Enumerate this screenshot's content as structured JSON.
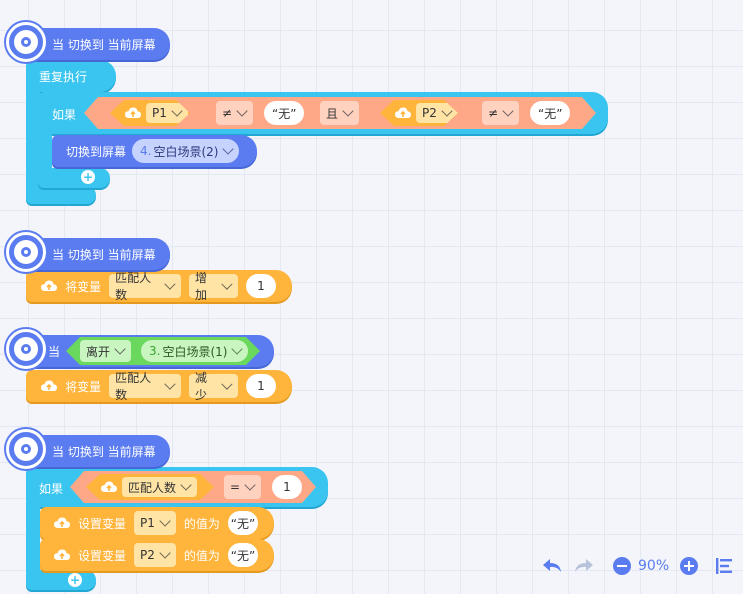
{
  "hat_label": "当 切换到 当前屏幕",
  "script1": {
    "repeat_label": "重复执行",
    "if_label": "如果",
    "left_var": "P1",
    "left_op": "≠",
    "left_value": "“无”",
    "and_label": "且",
    "right_var": "P2",
    "right_op": "≠",
    "right_value": "“无”",
    "switch_label": "切换到屏幕",
    "switch_scene_num": "4.",
    "switch_scene_name": "空白场景(2)"
  },
  "script2": {
    "set_label": "将变量",
    "var_name": "匹配人数",
    "action": "增加",
    "amount": "1"
  },
  "script3": {
    "when_label": "当",
    "event": "离开",
    "scene_num": "3.",
    "scene_name": "空白场景(1)",
    "set_label": "将变量",
    "var_name": "匹配人数",
    "action": "减少",
    "amount": "1"
  },
  "script4": {
    "if_label": "如果",
    "var_name": "匹配人数",
    "op": "=",
    "value": "1",
    "set_label": "设置变量",
    "var1": "P1",
    "var2": "P2",
    "value_of_label": "的值为",
    "assign_value": "“无”"
  },
  "toolbar": {
    "zoom": "90%"
  },
  "colors": {
    "event_blue": "#5b7cf0",
    "control_cyan": "#39c5ef",
    "variable_orange": "#ffb43c",
    "operator_salmon": "#ffa887",
    "scene_green": "#6ad85d"
  }
}
